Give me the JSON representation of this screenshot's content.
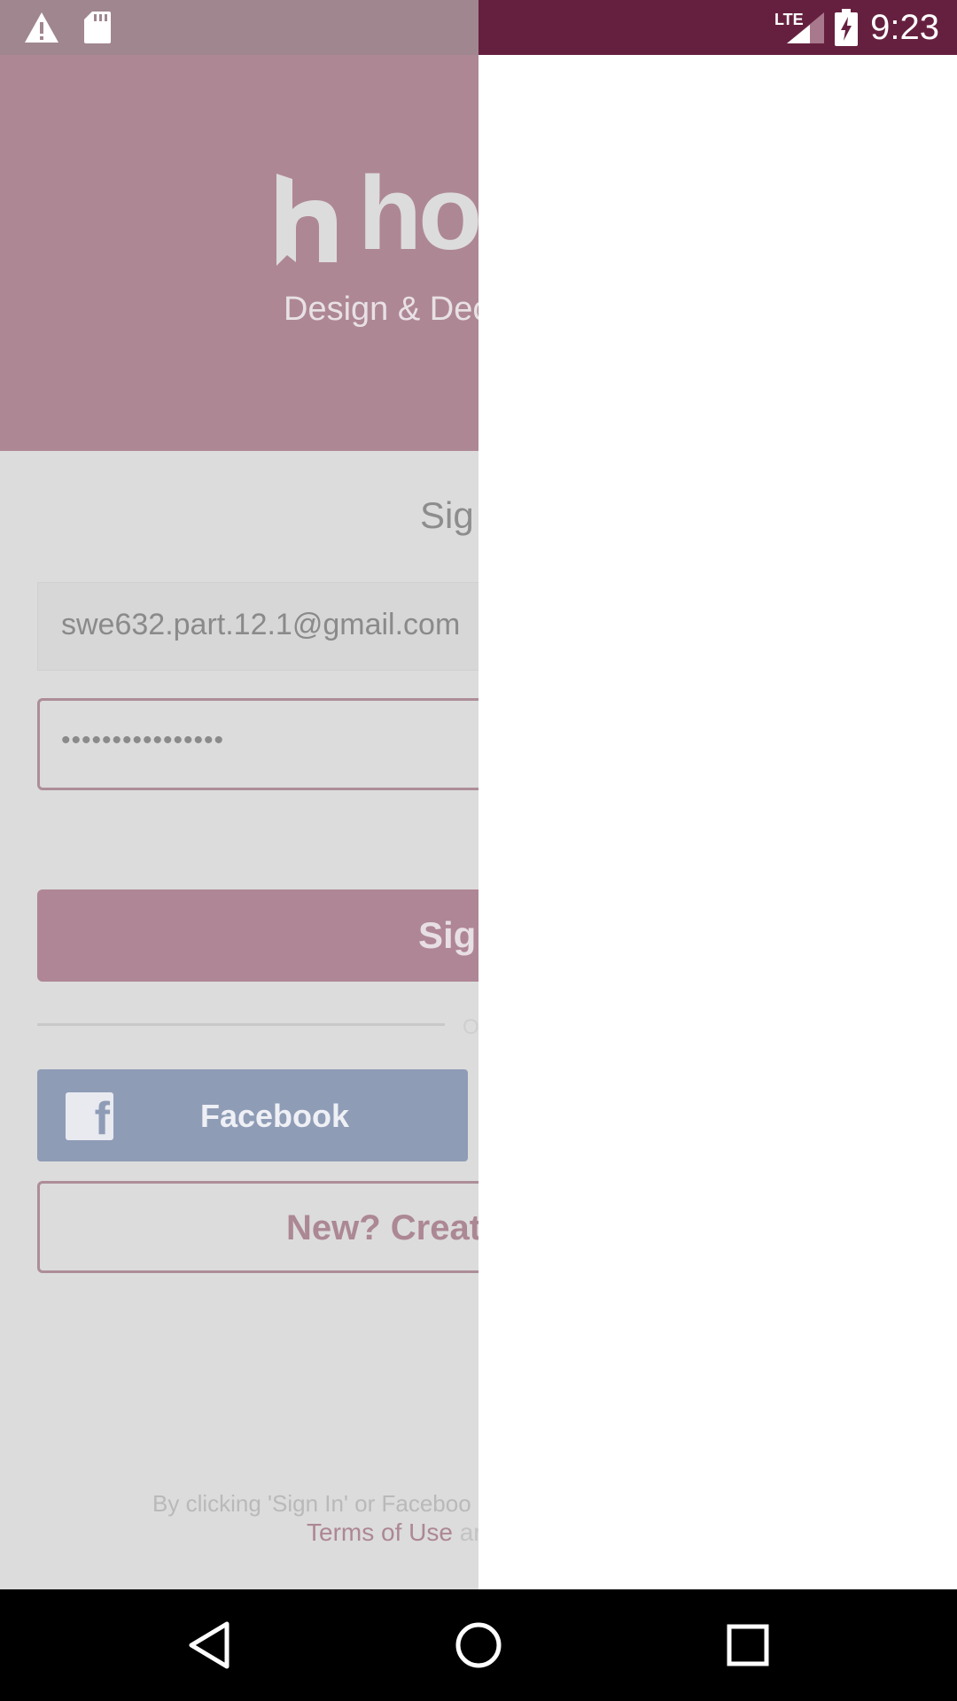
{
  "status_bar": {
    "time": "9:23",
    "network": "LTE",
    "icons": [
      "warning-icon",
      "sd-card-icon",
      "signal-icon",
      "battery-charging-icon"
    ]
  },
  "header": {
    "logo": "ho",
    "tagline": "Design & Dec"
  },
  "form": {
    "title": "Sig",
    "email_value": "swe632.part.12.1@gmail.com",
    "password_mask": "••••••••••••••••",
    "signin_label": "Sig",
    "divider_text": "O"
  },
  "social": {
    "facebook_label": "Facebook"
  },
  "create": {
    "label": "New? Create"
  },
  "legal": {
    "line1": "By clicking 'Sign In' or Faceboo",
    "terms_link": "Terms of Use",
    "line2_rest": " an"
  },
  "colors": {
    "status_right": "#66203f",
    "brand": "#ae8795",
    "facebook": "#8f9cb6"
  }
}
